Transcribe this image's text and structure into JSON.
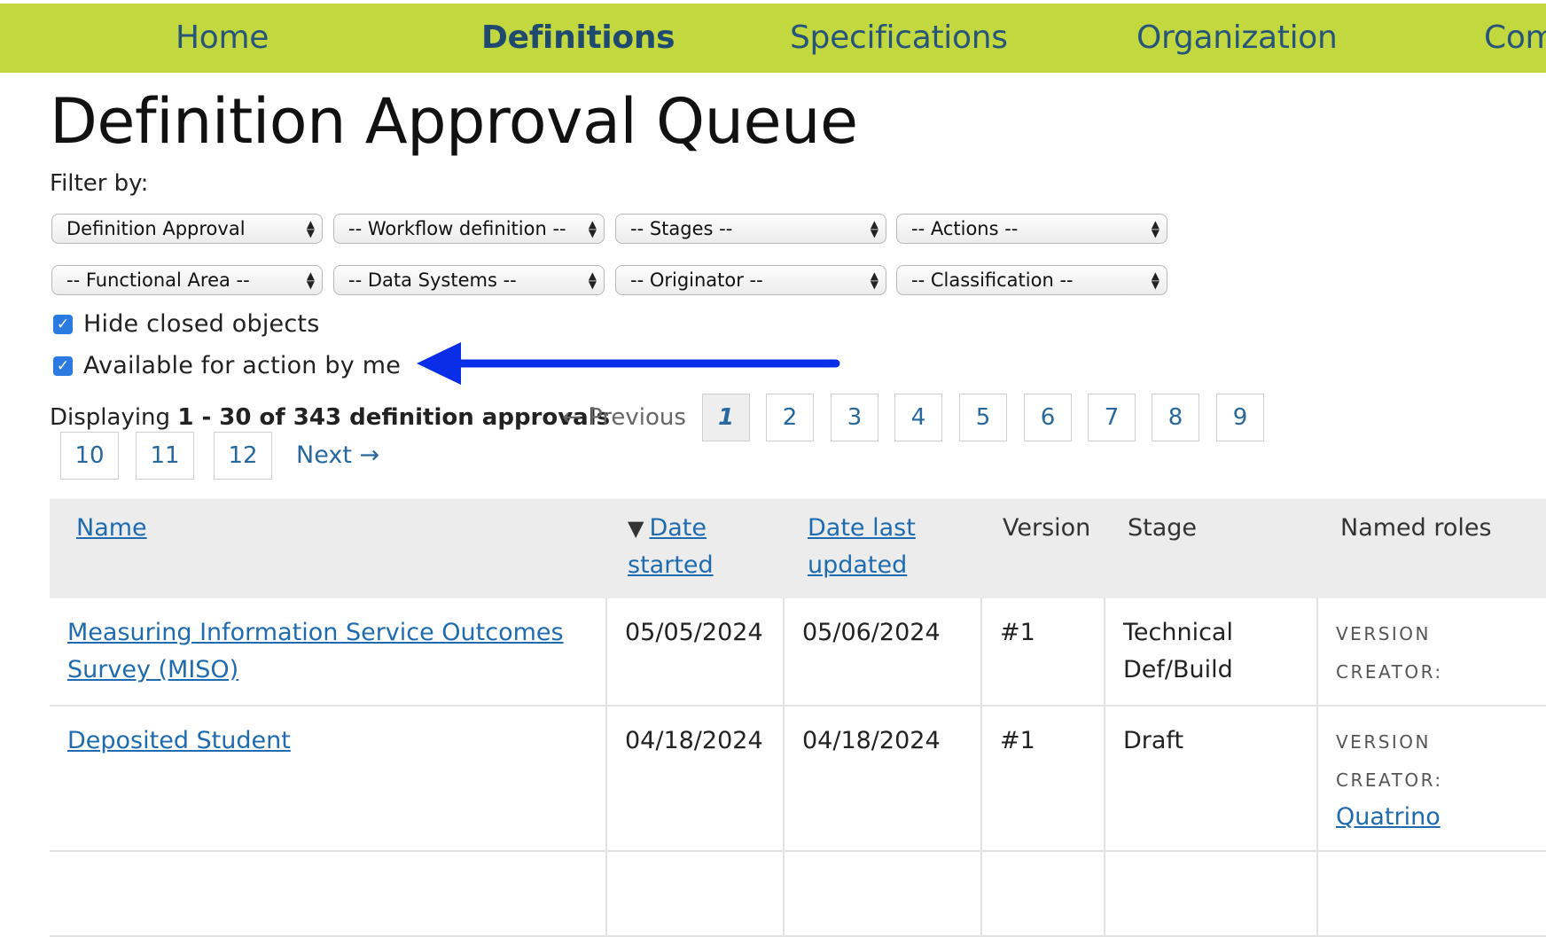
{
  "nav": {
    "items": [
      {
        "label": "Home",
        "active": false
      },
      {
        "label": "Definitions",
        "active": true
      },
      {
        "label": "Specifications",
        "active": false
      },
      {
        "label": "Organization",
        "active": false
      },
      {
        "label": "Com",
        "active": false
      }
    ]
  },
  "page": {
    "title": "Definition Approval Queue"
  },
  "filters": {
    "label": "Filter by:",
    "row1": [
      "Definition Approval",
      "-- Workflow definition --",
      "-- Stages --",
      "-- Actions --"
    ],
    "row2": [
      "-- Functional Area --",
      "-- Data Systems --",
      "-- Originator --",
      "-- Classification --"
    ]
  },
  "checkboxes": [
    {
      "label": "Hide closed objects",
      "checked": true
    },
    {
      "label": "Available for action by me",
      "checked": true
    }
  ],
  "annotation": {
    "arrow_color": "#0a2ee8"
  },
  "pagination": {
    "prefix": "Displaying",
    "range": "1 - 30 of 343 definition approvals",
    "previous": "← Previous",
    "pages": [
      "1",
      "2",
      "3",
      "4",
      "5",
      "6",
      "7",
      "8",
      "9",
      "10",
      "11",
      "12"
    ],
    "current": "1",
    "next": "Next →"
  },
  "table": {
    "headers": {
      "name": "Name",
      "sort_icon": "▼",
      "date_started_1": "Date",
      "date_started_2": "started",
      "date_updated_1": "Date last",
      "date_updated_2": "updated",
      "version": "Version",
      "stage": "Stage",
      "roles": "Named roles"
    },
    "rows": [
      {
        "name_1": "Measuring Information Service Outcomes",
        "name_2": "Survey (MISO)",
        "date_started": "05/05/2024",
        "date_updated": "05/06/2024",
        "version": "#1",
        "stage_1": "Technical",
        "stage_2": "Def/Build",
        "role_label": "VERSION CREATOR:",
        "role_value": ""
      },
      {
        "name_1": "Deposited Student",
        "name_2": "",
        "date_started": "04/18/2024",
        "date_updated": "04/18/2024",
        "version": "#1",
        "stage_1": "Draft",
        "stage_2": "",
        "role_label": "VERSION CREATOR:",
        "role_value": "Quatrino"
      }
    ]
  },
  "colors": {
    "nav_bg": "#c3d83f",
    "link": "#1f6bb0",
    "checkbox": "#2a7ae2"
  }
}
